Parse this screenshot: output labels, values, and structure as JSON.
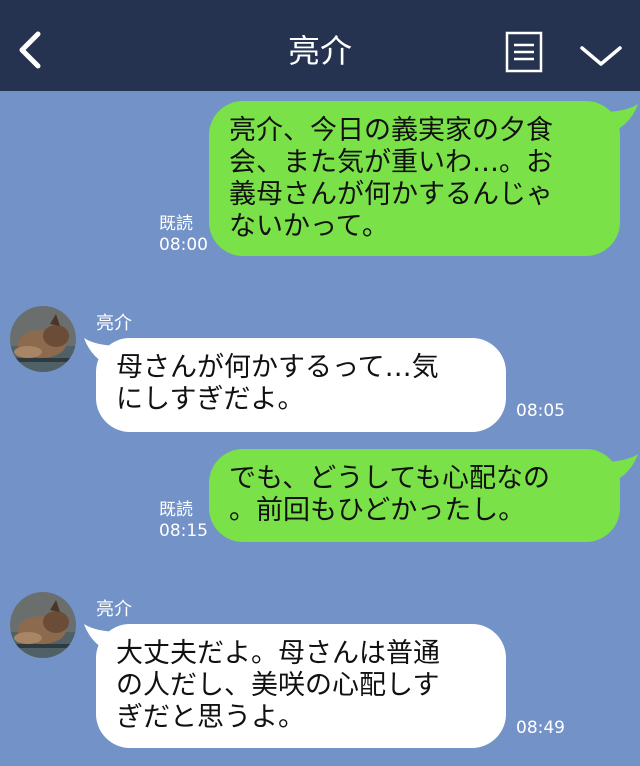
{
  "header": {
    "title": "亮介",
    "back_icon": "chevron-left-icon",
    "notes_icon": "notes-icon",
    "menu_icon": "chevron-down-icon",
    "bg_color": "#253350"
  },
  "chat": {
    "bg_color": "#7393c8",
    "messages": [
      {
        "from": "me",
        "text": "亮介、今日の義実家の夕食\n会、また気が重いわ…。お\n義母さんが何かするんじゃ\nないかって。",
        "read": "既読",
        "time": "08:00"
      },
      {
        "from": "other",
        "sender": "亮介",
        "text": "母さんが何かするって…気\nにしすぎだよ。",
        "time": "08:05"
      },
      {
        "from": "me",
        "text": "でも、どうしても心配なの\n。前回もひどかったし。",
        "read": "既読",
        "time": "08:15"
      },
      {
        "from": "other",
        "sender": "亮介",
        "text": "大丈夫だよ。母さんは普通\nの人だし、美咲の心配しす\nぎだと思うよ。",
        "time": "08:49"
      }
    ]
  }
}
